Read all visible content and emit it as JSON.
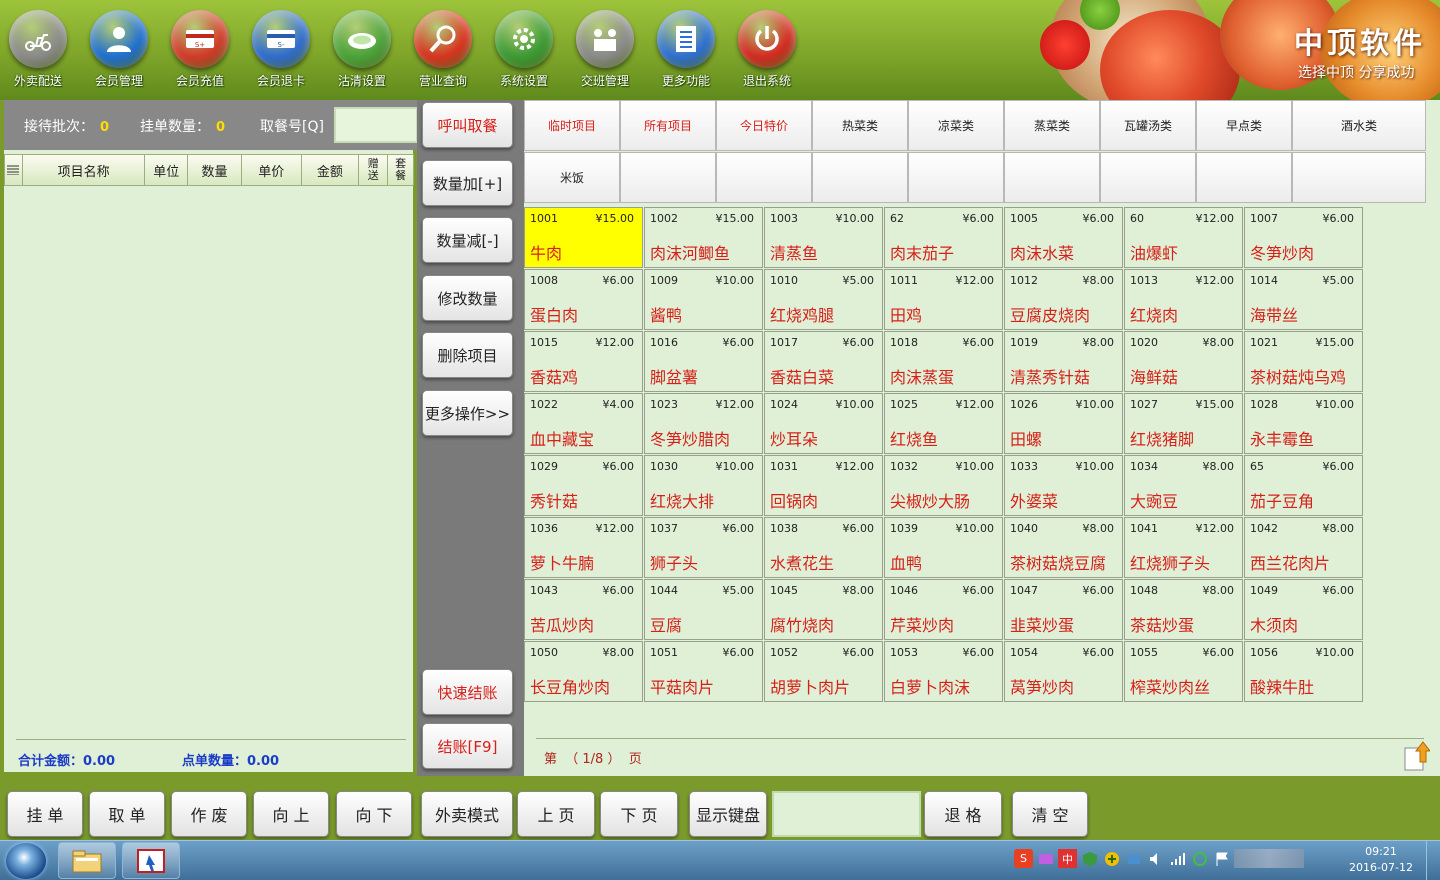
{
  "toolbar": [
    {
      "label": "外卖配送",
      "icon": "scooter-icon",
      "color": "#8a8a8a"
    },
    {
      "label": "会员管理",
      "icon": "member-icon",
      "color": "#1f6fd0"
    },
    {
      "label": "会员充值",
      "icon": "card-recharge-icon",
      "color": "#d23a2a"
    },
    {
      "label": "会员退卡",
      "icon": "card-refund-icon",
      "color": "#2f6ccf"
    },
    {
      "label": "沽清设置",
      "icon": "plate-icon",
      "color": "#4ba23a"
    },
    {
      "label": "营业查询",
      "icon": "magnifier-icon",
      "color": "#d83420"
    },
    {
      "label": "系统设置",
      "icon": "gear-icon",
      "color": "#3c9a34"
    },
    {
      "label": "交班管理",
      "icon": "shift-icon",
      "color": "#8a8a8a"
    },
    {
      "label": "更多功能",
      "icon": "document-icon",
      "color": "#2e6fd2"
    },
    {
      "label": "退出系统",
      "icon": "power-icon",
      "color": "#d42a22"
    }
  ],
  "banner": {
    "brand": "中顶软件",
    "slogan": "选择中顶 分享成功"
  },
  "order_panel": {
    "batch_label": "接待批次：",
    "batch_value": "0",
    "hold_label": "挂单数量：",
    "hold_value": "0",
    "pickup_label": "取餐号[Q]",
    "pickup_value": "",
    "columns": [
      "项目名称",
      "单位",
      "数量",
      "单价",
      "金额",
      "赠送",
      "套餐"
    ],
    "total_label": "合计金额：",
    "total_value": "0.00",
    "count_label": "点单数量：",
    "count_value": "0.00"
  },
  "actions": {
    "call": "呼叫取餐",
    "qty_plus": "数量加[+]",
    "qty_minus": "数量减[-]",
    "edit_qty": "修改数量",
    "delete_item": "删除项目",
    "more_ops": "更多操作>>",
    "quick_checkout": "快速结账",
    "checkout": "结账[F9]"
  },
  "categories": {
    "row1": [
      "临时项目",
      "所有项目",
      "今日特价",
      "热菜类",
      "凉菜类",
      "蒸菜类",
      "瓦罐汤类",
      "早点类",
      "酒水类"
    ],
    "row2": [
      "米饭",
      "",
      "",
      "",
      "",
      "",
      "",
      "",
      ""
    ],
    "selected": "所有项目"
  },
  "dishes": [
    {
      "code": "1001",
      "price": "¥15.00",
      "name": "牛肉",
      "selected": true
    },
    {
      "code": "1002",
      "price": "¥15.00",
      "name": "肉沫河鲫鱼"
    },
    {
      "code": "1003",
      "price": "¥10.00",
      "name": "清蒸鱼"
    },
    {
      "code": "62",
      "price": "¥6.00",
      "name": "肉末茄子"
    },
    {
      "code": "1005",
      "price": "¥6.00",
      "name": "肉沫水菜"
    },
    {
      "code": "60",
      "price": "¥12.00",
      "name": "油爆虾"
    },
    {
      "code": "1007",
      "price": "¥6.00",
      "name": "冬笋炒肉"
    },
    {
      "code": "1008",
      "price": "¥6.00",
      "name": "蛋白肉"
    },
    {
      "code": "1009",
      "price": "¥10.00",
      "name": "酱鸭"
    },
    {
      "code": "1010",
      "price": "¥5.00",
      "name": "红烧鸡腿"
    },
    {
      "code": "1011",
      "price": "¥12.00",
      "name": "田鸡"
    },
    {
      "code": "1012",
      "price": "¥8.00",
      "name": "豆腐皮烧肉"
    },
    {
      "code": "1013",
      "price": "¥12.00",
      "name": "红烧肉"
    },
    {
      "code": "1014",
      "price": "¥5.00",
      "name": "海带丝"
    },
    {
      "code": "1015",
      "price": "¥12.00",
      "name": "香菇鸡"
    },
    {
      "code": "1016",
      "price": "¥6.00",
      "name": "脚盆薯"
    },
    {
      "code": "1017",
      "price": "¥6.00",
      "name": "香菇白菜"
    },
    {
      "code": "1018",
      "price": "¥6.00",
      "name": "肉沫蒸蛋"
    },
    {
      "code": "1019",
      "price": "¥8.00",
      "name": "清蒸秀针菇"
    },
    {
      "code": "1020",
      "price": "¥8.00",
      "name": "海鲜菇"
    },
    {
      "code": "1021",
      "price": "¥15.00",
      "name": "茶树菇炖乌鸡"
    },
    {
      "code": "1022",
      "price": "¥4.00",
      "name": "血中藏宝"
    },
    {
      "code": "1023",
      "price": "¥12.00",
      "name": "冬笋炒腊肉"
    },
    {
      "code": "1024",
      "price": "¥10.00",
      "name": "炒耳朵"
    },
    {
      "code": "1025",
      "price": "¥12.00",
      "name": "红烧鱼"
    },
    {
      "code": "1026",
      "price": "¥10.00",
      "name": "田螺"
    },
    {
      "code": "1027",
      "price": "¥15.00",
      "name": "红烧猪脚"
    },
    {
      "code": "1028",
      "price": "¥10.00",
      "name": "永丰霉鱼"
    },
    {
      "code": "1029",
      "price": "¥6.00",
      "name": "秀针菇"
    },
    {
      "code": "1030",
      "price": "¥10.00",
      "name": "红烧大排"
    },
    {
      "code": "1031",
      "price": "¥12.00",
      "name": "回锅肉"
    },
    {
      "code": "1032",
      "price": "¥10.00",
      "name": "尖椒炒大肠"
    },
    {
      "code": "1033",
      "price": "¥10.00",
      "name": "外婆菜"
    },
    {
      "code": "1034",
      "price": "¥8.00",
      "name": "大豌豆"
    },
    {
      "code": "65",
      "price": "¥6.00",
      "name": "茄子豆角"
    },
    {
      "code": "1036",
      "price": "¥12.00",
      "name": "萝卜牛腩"
    },
    {
      "code": "1037",
      "price": "¥6.00",
      "name": "狮子头"
    },
    {
      "code": "1038",
      "price": "¥6.00",
      "name": "水煮花生"
    },
    {
      "code": "1039",
      "price": "¥10.00",
      "name": "血鸭"
    },
    {
      "code": "1040",
      "price": "¥8.00",
      "name": "茶树菇烧豆腐"
    },
    {
      "code": "1041",
      "price": "¥12.00",
      "name": "红烧狮子头"
    },
    {
      "code": "1042",
      "price": "¥8.00",
      "name": "西兰花肉片"
    },
    {
      "code": "1043",
      "price": "¥6.00",
      "name": "苦瓜炒肉"
    },
    {
      "code": "1044",
      "price": "¥5.00",
      "name": "豆腐"
    },
    {
      "code": "1045",
      "price": "¥8.00",
      "name": "腐竹烧肉"
    },
    {
      "code": "1046",
      "price": "¥6.00",
      "name": "芹菜炒肉"
    },
    {
      "code": "1047",
      "price": "¥6.00",
      "name": "韭菜炒蛋"
    },
    {
      "code": "1048",
      "price": "¥8.00",
      "name": "茶菇炒蛋"
    },
    {
      "code": "1049",
      "price": "¥6.00",
      "name": "木须肉"
    },
    {
      "code": "1050",
      "price": "¥8.00",
      "name": "长豆角炒肉"
    },
    {
      "code": "1051",
      "price": "¥6.00",
      "name": "平菇肉片"
    },
    {
      "code": "1052",
      "price": "¥6.00",
      "name": "胡萝卜肉片"
    },
    {
      "code": "1053",
      "price": "¥6.00",
      "name": "白萝卜肉沫"
    },
    {
      "code": "1054",
      "price": "¥6.00",
      "name": "莴笋炒肉"
    },
    {
      "code": "1055",
      "price": "¥6.00",
      "name": "榨菜炒肉丝"
    },
    {
      "code": "1056",
      "price": "¥10.00",
      "name": "酸辣牛肚"
    }
  ],
  "pager": {
    "text": "第  （ 1/8 ）  页"
  },
  "bottom_buttons": [
    "挂 单",
    "取 单",
    "作 废",
    "向 上",
    "向 下",
    "外卖模式",
    "上 页",
    "下 页",
    "显示键盘",
    "退 格",
    "清 空"
  ],
  "keyboard_input": "",
  "taskbar": {
    "time": "09:21",
    "date": "2016-07-12"
  }
}
